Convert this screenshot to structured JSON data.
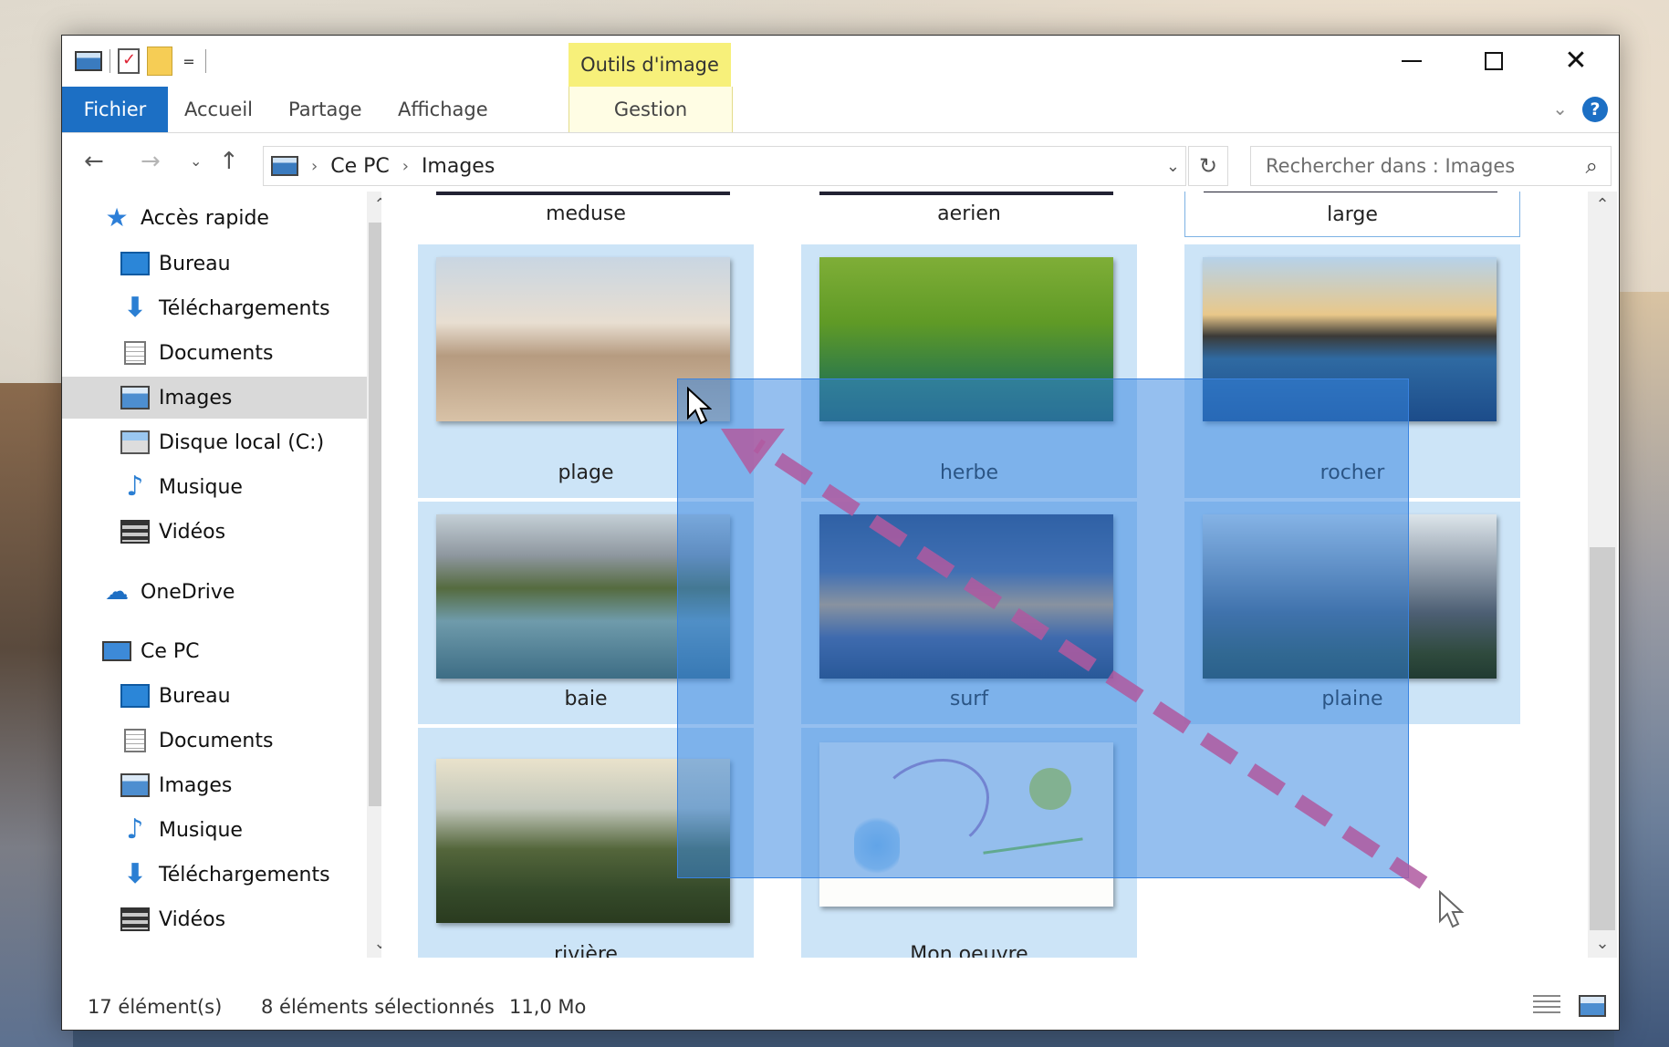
{
  "titlebar": {
    "context_tab": "Outils d'image",
    "qat_dropdown": "="
  },
  "ribbon": {
    "tabs": [
      {
        "label": "Fichier"
      },
      {
        "label": "Accueil"
      },
      {
        "label": "Partage"
      },
      {
        "label": "Affichage"
      },
      {
        "label": "Gestion"
      }
    ],
    "help": "?"
  },
  "address": {
    "crumbs": [
      "Ce PC",
      "Images"
    ],
    "search_placeholder": "Rechercher dans : Images"
  },
  "nav_pane": {
    "items": [
      {
        "label": "Accès rapide",
        "icon": "quick-access-star-icon",
        "pinned": false,
        "selected": false
      },
      {
        "label": "Bureau",
        "icon": "desktop-icon",
        "pinned": true,
        "selected": false
      },
      {
        "label": "Téléchargements",
        "icon": "downloads-icon",
        "pinned": true,
        "selected": false
      },
      {
        "label": "Documents",
        "icon": "documents-icon",
        "pinned": true,
        "selected": false
      },
      {
        "label": "Images",
        "icon": "pictures-icon",
        "pinned": true,
        "selected": true
      },
      {
        "label": "Disque local (C:)",
        "icon": "local-disk-icon",
        "pinned": true,
        "selected": false
      },
      {
        "label": "Musique",
        "icon": "music-icon",
        "pinned": false,
        "selected": false
      },
      {
        "label": "Vidéos",
        "icon": "videos-icon",
        "pinned": false,
        "selected": false
      },
      {
        "label": "OneDrive",
        "icon": "onedrive-icon",
        "pinned": false,
        "selected": false
      },
      {
        "label": "Ce PC",
        "icon": "this-pc-icon",
        "pinned": false,
        "selected": false
      },
      {
        "label": "Bureau",
        "icon": "desktop-icon",
        "pinned": false,
        "selected": false
      },
      {
        "label": "Documents",
        "icon": "documents-icon",
        "pinned": false,
        "selected": false
      },
      {
        "label": "Images",
        "icon": "pictures-icon",
        "pinned": false,
        "selected": false
      },
      {
        "label": "Musique",
        "icon": "music-icon",
        "pinned": false,
        "selected": false
      },
      {
        "label": "Téléchargements",
        "icon": "downloads-icon",
        "pinned": false,
        "selected": false
      },
      {
        "label": "Vidéos",
        "icon": "videos-icon",
        "pinned": false,
        "selected": false
      }
    ]
  },
  "files": {
    "top_row": [
      "meduse",
      "aerien",
      "large"
    ],
    "items": [
      {
        "label": "plage",
        "selected": true
      },
      {
        "label": "herbe",
        "selected": true
      },
      {
        "label": "rocher",
        "selected": true
      },
      {
        "label": "baie",
        "selected": true
      },
      {
        "label": "surf",
        "selected": true
      },
      {
        "label": "plaine",
        "selected": true
      },
      {
        "label": "rivière",
        "selected": true
      },
      {
        "label": "Mon oeuvre",
        "selected": true
      }
    ]
  },
  "status": {
    "count": "17 élément(s)",
    "selection": "8 éléments sélectionnés",
    "size": "11,0 Mo"
  },
  "colors": {
    "accent": "#1c6fc4",
    "selection_fill": "#cce4f7",
    "marquee": "#3385e1",
    "drag_arrow": "#b05aa0",
    "context_tab": "#f7f07a"
  }
}
